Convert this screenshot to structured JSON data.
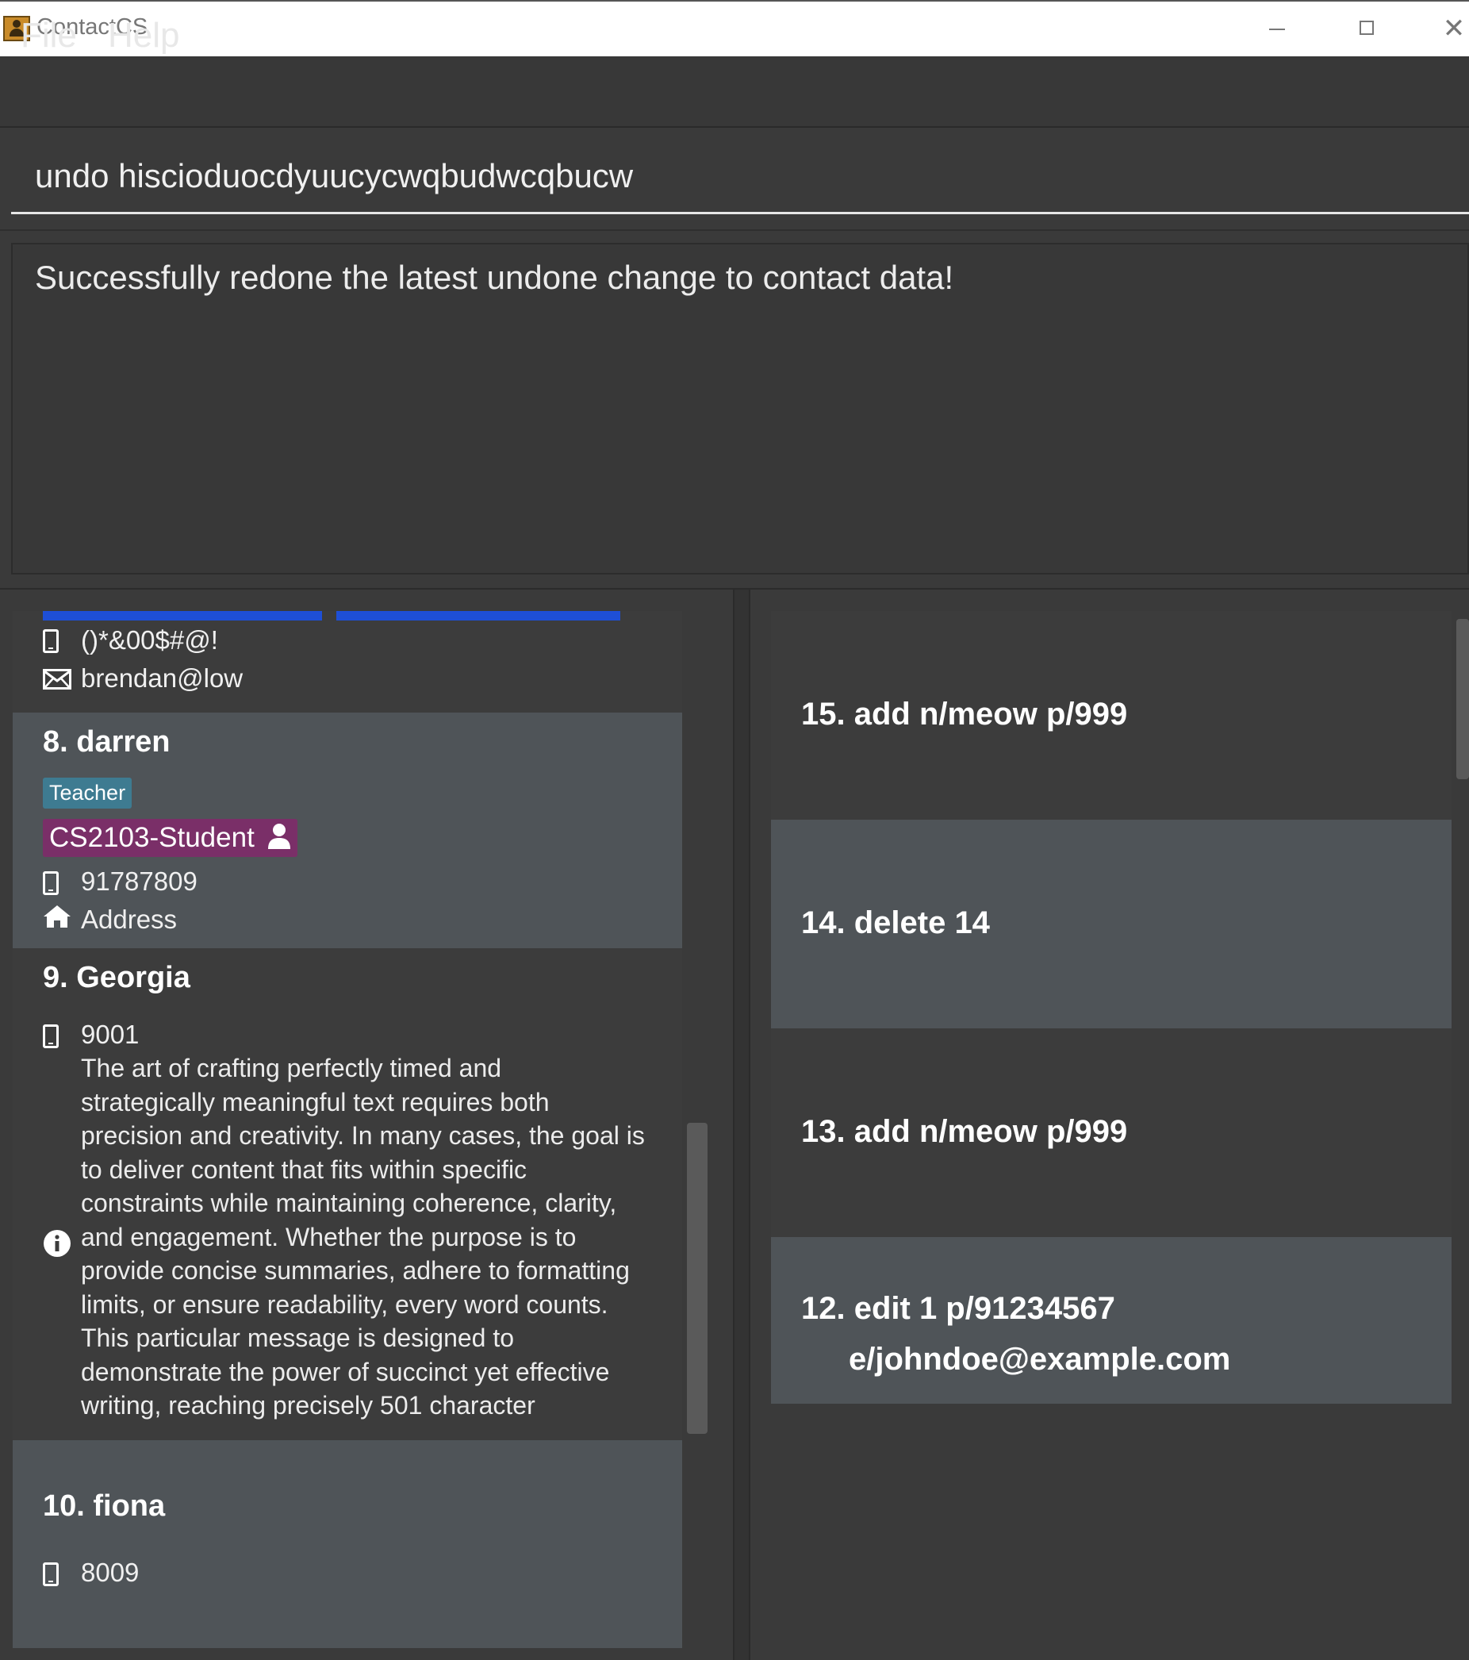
{
  "window": {
    "title": "ContactCS",
    "close_glyph": "✕"
  },
  "menu": {
    "file": "File",
    "help": "Help"
  },
  "command": {
    "value": "undo hiscioduocdyuucycwqbudwcqbucw"
  },
  "result": {
    "text": "Successfully redone the latest undone change to contact data!"
  },
  "persons": {
    "partial": {
      "phone": "()*&00$#@!",
      "email": "brendan@low"
    },
    "darren": {
      "name": "8. darren",
      "tags": [
        "Teacher",
        "CS2103-Student"
      ],
      "phone": "91787809",
      "address": "Address"
    },
    "georgia": {
      "name": "9. Georgia",
      "phone": "9001",
      "remark_lines": [
        "The art of crafting perfectly timed and",
        "strategically meaningful text requires both",
        "precision and creativity. In many cases, the goal is",
        "to deliver content that fits within specific",
        "constraints while maintaining coherence, clarity,",
        "and engagement. Whether the purpose is to",
        "provide concise summaries, adhere to formatting",
        "limits, or ensure readability, every word counts.",
        "This particular message is designed to",
        "demonstrate the power of succinct yet effective",
        "writing, reaching precisely 501 character"
      ]
    },
    "fiona": {
      "name": "10. fiona",
      "phone": "8009"
    }
  },
  "history": [
    {
      "lines": [
        "15. add n/meow p/999"
      ]
    },
    {
      "lines": [
        "14. delete 14"
      ]
    },
    {
      "lines": [
        "13. add n/meow p/999"
      ]
    },
    {
      "lines": [
        "12.  edit 1 p/91234567",
        "e/johndoe@example.com"
      ]
    }
  ],
  "colors": {
    "tag_teacher": "#3e7b91",
    "tag_student": "#7a2f68",
    "tag_blue": "#1e4fd6",
    "card_dark": "#3c3c3c",
    "card_light": "#4f5458"
  },
  "icons": [
    "app-icon",
    "phone-icon",
    "email-icon",
    "home-icon",
    "info-icon",
    "user-icon",
    "minimize-icon",
    "maximize-icon",
    "close-icon"
  ]
}
